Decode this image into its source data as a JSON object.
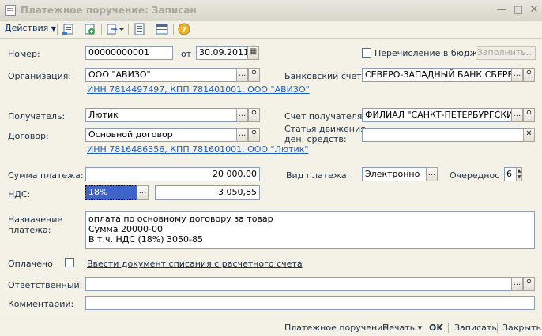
{
  "window": {
    "title": "Платежное поручение: Записан"
  },
  "toolbar": {
    "actions_label": "Действия"
  },
  "form": {
    "nomer_label": "Номер:",
    "nomer_value": "00000000001",
    "ot_label": "от",
    "date_value": "30.09.2011",
    "budget_label": "Перечисление в бюджет",
    "fill_button": "Заполнить...",
    "org_label": "Организация:",
    "org_value": "ООО \"АВИЗО\"",
    "org_link": "ИНН 7814497497, КПП 781401001, ООО \"АВИЗО\"",
    "bank_label": "Банковский счет:",
    "bank_value": "СЕВЕРО-ЗАПАДНЫЙ БАНК СБЕРБА",
    "recipient_label": "Получатель:",
    "recipient_value": "Лютик",
    "recipient_account_label": "Счет получателя:",
    "recipient_account_value": "ФИЛИАЛ \"САНКТ-ПЕТЕРБУРГСКИ",
    "contract_label": "Договор:",
    "contract_value": "Основной договор",
    "cashflow_label_1": "Статья движения",
    "cashflow_label_2": "ден. средств:",
    "cashflow_value": "",
    "recipient_link": "ИНН 7816486356, КПП 781601001, ООО \"Лютик\"",
    "sum_label": "Сумма платежа:",
    "sum_value": "20 000,00",
    "payment_type_label": "Вид платежа:",
    "payment_type_value": "Электронно",
    "priority_label": "Очередность:",
    "priority_value": "6",
    "vat_label": "НДС:",
    "vat_rate_value": "18%",
    "vat_sum_value": "3 050,85",
    "purpose_label_1": "Назначение",
    "purpose_label_2": "платежа:",
    "purpose_line_1": "оплата по основному договору за товар",
    "purpose_line_2": "Сумма 20000-00",
    "purpose_line_3": "В т.ч. НДС  (18%) 3050-85",
    "paid_label": "Оплачено",
    "writeoff_link": "Ввести документ списания с расчетного счета",
    "responsible_label": "Ответственный:",
    "responsible_value": "",
    "comment_label": "Комментарий:",
    "comment_value": ""
  },
  "statusbar": {
    "print_form": "Платежное поручение",
    "print_label": "Печать ▾",
    "ok_label": "OK",
    "save_label": "Записать",
    "close_label": "Закрыть"
  },
  "icons": [
    "document-icon",
    "minimize-icon",
    "maximize-icon",
    "close-icon",
    "dropdown-arrow-icon",
    "list-icon",
    "new-copy-icon",
    "go-to-icon",
    "structure-icon",
    "table-icon",
    "help-icon",
    "calendar-icon",
    "search-icon",
    "ellipsis-icon",
    "clear-icon",
    "spin-icon"
  ],
  "colors": {
    "link": "#1f5fbf",
    "selection": "#3f64c9",
    "border": "#8a9cb5"
  }
}
